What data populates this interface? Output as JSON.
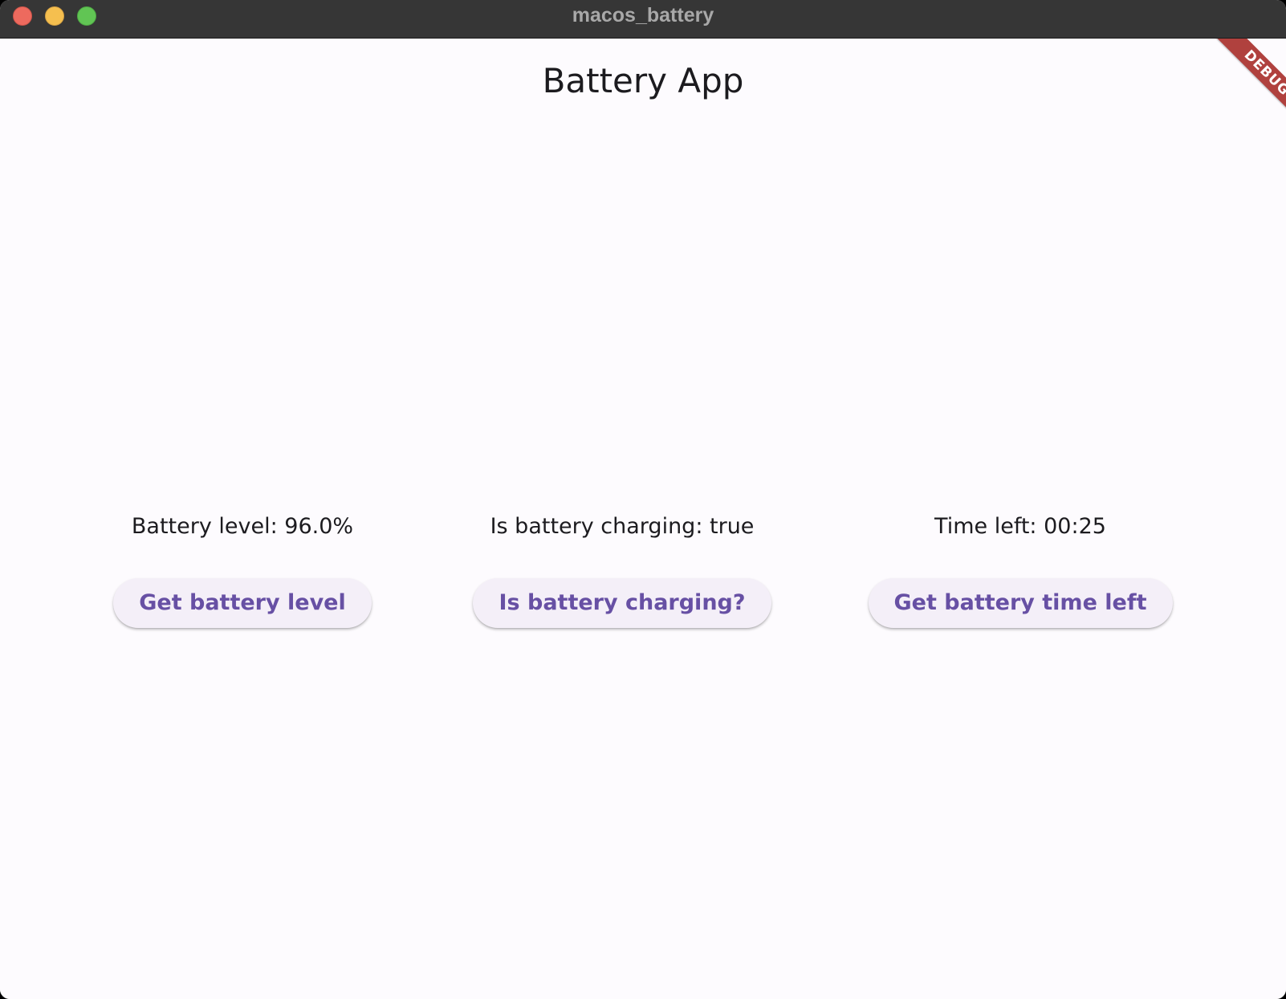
{
  "window": {
    "title": "macos_battery"
  },
  "app": {
    "title": "Battery App",
    "debug_banner": "DEBUG"
  },
  "battery_level": {
    "status": "Battery level: 96.0%",
    "button_label": "Get battery level"
  },
  "charging": {
    "status": "Is battery charging: true",
    "button_label": "Is battery charging?"
  },
  "time_left": {
    "status": "Time left: 00:25",
    "button_label": "Get battery time left"
  },
  "colors": {
    "titlebar": "#363636",
    "background": "#fdfbfe",
    "button_background": "#f4eff8",
    "button_text": "#6750a4",
    "debug_ribbon": "#b0413e",
    "close": "#ed6a5e",
    "minimize": "#f5bf4f",
    "zoom": "#61c554"
  }
}
